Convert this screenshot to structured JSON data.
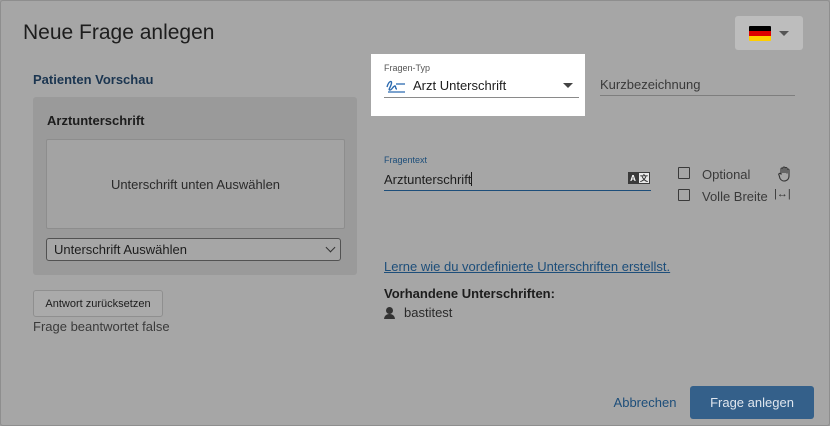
{
  "dialog": {
    "title": "Neue Frage anlegen"
  },
  "language": {
    "flag": "de-flag",
    "colors": [
      "#000000",
      "#dd0000",
      "#ffce00"
    ]
  },
  "preview": {
    "section_label": "Patienten Vorschau",
    "card_title": "Arztunterschrift",
    "signature_placeholder": "Unterschrift unten Auswählen",
    "select_value": "Unterschrift Auswählen",
    "reset_button": "Antwort zurücksetzen",
    "answered_status": "Frage beantwortet false"
  },
  "form": {
    "question_type_label": "Fragen-Typ",
    "question_type_value": "Arzt Unterschrift",
    "question_type_icon": "signature-icon",
    "short_name_placeholder": "Kurzbezeichnung",
    "question_text_label": "Fragentext",
    "question_text_value": "Arztunterschrift",
    "translate_icon": "translate-icon",
    "optional_label": "Optional",
    "full_width_label": "Volle Breite",
    "full_width_icon_text": "|↔|",
    "learn_link": "Lerne wie du vordefinierte Unterschriften erstellst.",
    "existing_title": "Vorhandene Unterschriften:",
    "existing_signatures": [
      {
        "name": "bastitest",
        "icon": "user-icon"
      }
    ]
  },
  "footer": {
    "cancel_button": "Abbrechen",
    "create_button": "Frage anlegen"
  },
  "colors": {
    "accent": "#34608a",
    "link": "#1d4e7a",
    "signature_icon": "#2c6bb0"
  }
}
